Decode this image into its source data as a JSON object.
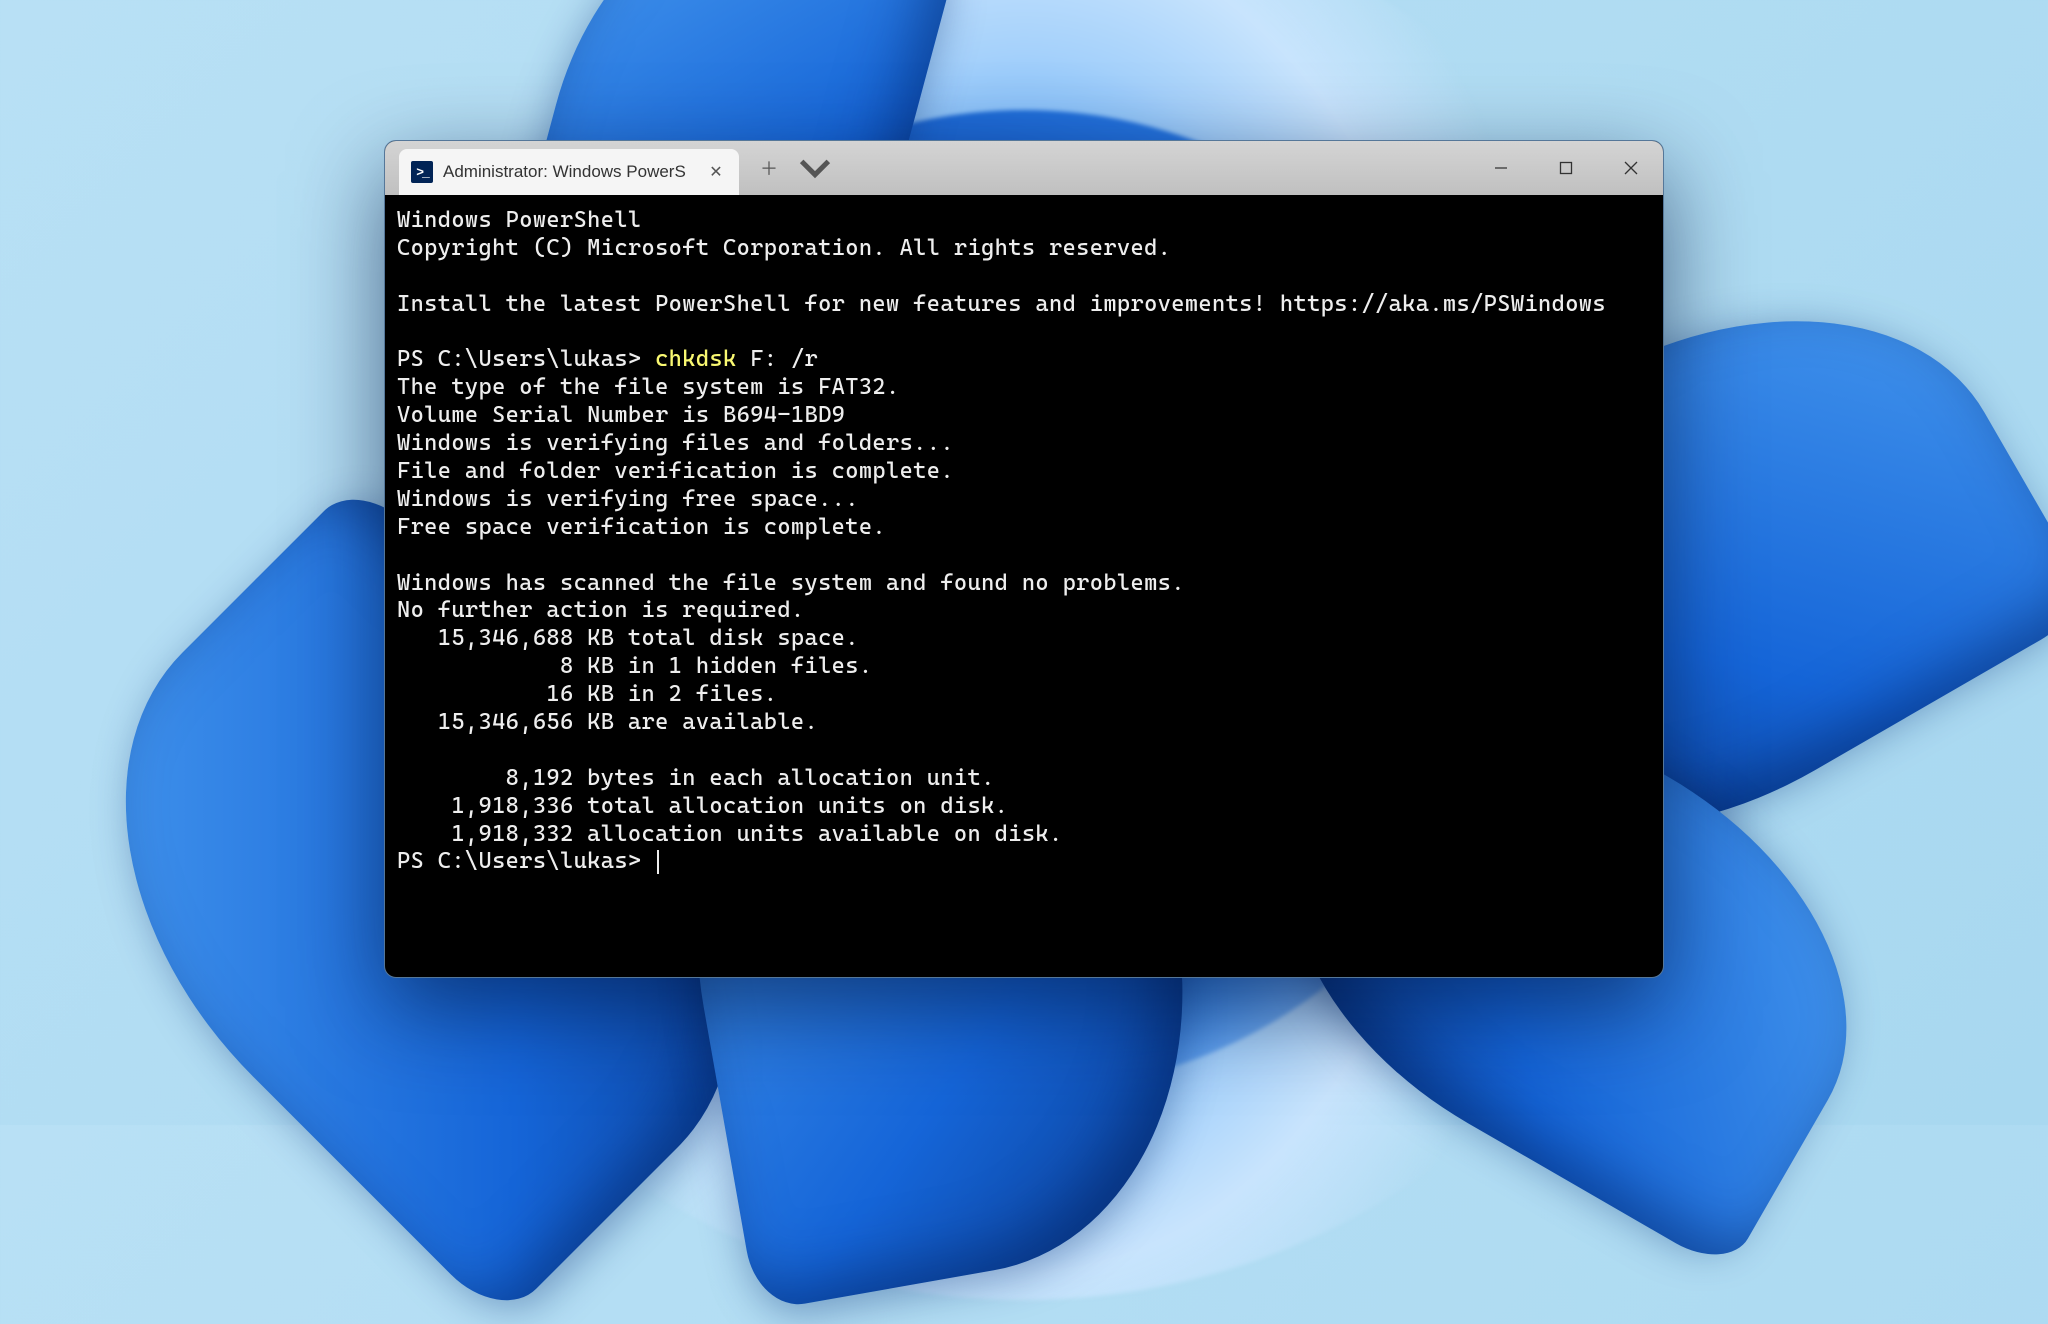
{
  "tab": {
    "label": "Administrator: Windows PowerS"
  },
  "terminal": {
    "header": [
      "Windows PowerShell",
      "Copyright (C) Microsoft Corporation. All rights reserved.",
      "",
      "Install the latest PowerShell for new features and improvements! https://aka.ms/PSWindows",
      ""
    ],
    "prompt1_prefix": "PS C:\\Users\\lukas> ",
    "prompt1_cmd": "chkdsk",
    "prompt1_args": " F: /r",
    "output": [
      "The type of the file system is FAT32.",
      "Volume Serial Number is B694-1BD9",
      "Windows is verifying files and folders...",
      "File and folder verification is complete.",
      "Windows is verifying free space...",
      "Free space verification is complete.",
      "",
      "Windows has scanned the file system and found no problems.",
      "No further action is required.",
      "   15,346,688 KB total disk space.",
      "            8 KB in 1 hidden files.",
      "           16 KB in 2 files.",
      "   15,346,656 KB are available.",
      "",
      "        8,192 bytes in each allocation unit.",
      "    1,918,336 total allocation units on disk.",
      "    1,918,332 allocation units available on disk."
    ],
    "prompt2": "PS C:\\Users\\lukas> "
  }
}
